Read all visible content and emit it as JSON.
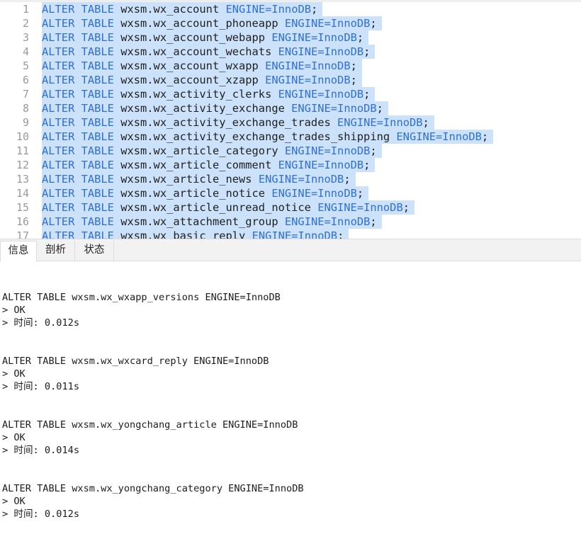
{
  "editor": {
    "lines": [
      {
        "no": "1",
        "kw": "ALTER TABLE",
        "table": "wxsm.wx_account",
        "engine_kw": "ENGINE",
        "engine_val": "InnoDB"
      },
      {
        "no": "2",
        "kw": "ALTER TABLE",
        "table": "wxsm.wx_account_phoneapp",
        "engine_kw": "ENGINE",
        "engine_val": "InnoDB"
      },
      {
        "no": "3",
        "kw": "ALTER TABLE",
        "table": "wxsm.wx_account_webapp",
        "engine_kw": "ENGINE",
        "engine_val": "InnoDB"
      },
      {
        "no": "4",
        "kw": "ALTER TABLE",
        "table": "wxsm.wx_account_wechats",
        "engine_kw": "ENGINE",
        "engine_val": "InnoDB"
      },
      {
        "no": "5",
        "kw": "ALTER TABLE",
        "table": "wxsm.wx_account_wxapp",
        "engine_kw": "ENGINE",
        "engine_val": "InnoDB"
      },
      {
        "no": "6",
        "kw": "ALTER TABLE",
        "table": "wxsm.wx_account_xzapp",
        "engine_kw": "ENGINE",
        "engine_val": "InnoDB"
      },
      {
        "no": "7",
        "kw": "ALTER TABLE",
        "table": "wxsm.wx_activity_clerks",
        "engine_kw": "ENGINE",
        "engine_val": "InnoDB"
      },
      {
        "no": "8",
        "kw": "ALTER TABLE",
        "table": "wxsm.wx_activity_exchange",
        "engine_kw": "ENGINE",
        "engine_val": "InnoDB"
      },
      {
        "no": "9",
        "kw": "ALTER TABLE",
        "table": "wxsm.wx_activity_exchange_trades",
        "engine_kw": "ENGINE",
        "engine_val": "InnoDB"
      },
      {
        "no": "10",
        "kw": "ALTER TABLE",
        "table": "wxsm.wx_activity_exchange_trades_shipping",
        "engine_kw": "ENGINE",
        "engine_val": "InnoDB"
      },
      {
        "no": "11",
        "kw": "ALTER TABLE",
        "table": "wxsm.wx_article_category",
        "engine_kw": "ENGINE",
        "engine_val": "InnoDB"
      },
      {
        "no": "12",
        "kw": "ALTER TABLE",
        "table": "wxsm.wx_article_comment",
        "engine_kw": "ENGINE",
        "engine_val": "InnoDB"
      },
      {
        "no": "13",
        "kw": "ALTER TABLE",
        "table": "wxsm.wx_article_news",
        "engine_kw": "ENGINE",
        "engine_val": "InnoDB"
      },
      {
        "no": "14",
        "kw": "ALTER TABLE",
        "table": "wxsm.wx_article_notice",
        "engine_kw": "ENGINE",
        "engine_val": "InnoDB"
      },
      {
        "no": "15",
        "kw": "ALTER TABLE",
        "table": "wxsm.wx_article_unread_notice",
        "engine_kw": "ENGINE",
        "engine_val": "InnoDB"
      },
      {
        "no": "16",
        "kw": "ALTER TABLE",
        "table": "wxsm.wx_attachment_group",
        "engine_kw": "ENGINE",
        "engine_val": "InnoDB"
      },
      {
        "no": "17",
        "kw": "ALTER TABLE",
        "table": "wxsm.wx_basic_reply",
        "engine_kw": "ENGINE",
        "engine_val": "InnoDB"
      }
    ]
  },
  "tabs": [
    {
      "label": "信息",
      "active": true
    },
    {
      "label": "剖析",
      "active": false
    },
    {
      "label": "状态",
      "active": false
    }
  ],
  "log": {
    "entries": [
      {
        "statement": "ALTER TABLE wxsm.wx_wxapp_versions ENGINE=InnoDB",
        "result": "> OK",
        "time": "> 时间: 0.012s"
      },
      {
        "statement": "ALTER TABLE wxsm.wx_wxcard_reply ENGINE=InnoDB",
        "result": "> OK",
        "time": "> 时间: 0.011s"
      },
      {
        "statement": "ALTER TABLE wxsm.wx_yongchang_article ENGINE=InnoDB",
        "result": "> OK",
        "time": "> 时间: 0.014s"
      },
      {
        "statement": "ALTER TABLE wxsm.wx_yongchang_category ENGINE=InnoDB",
        "result": "> OK",
        "time": "> 时间: 0.012s"
      }
    ]
  }
}
